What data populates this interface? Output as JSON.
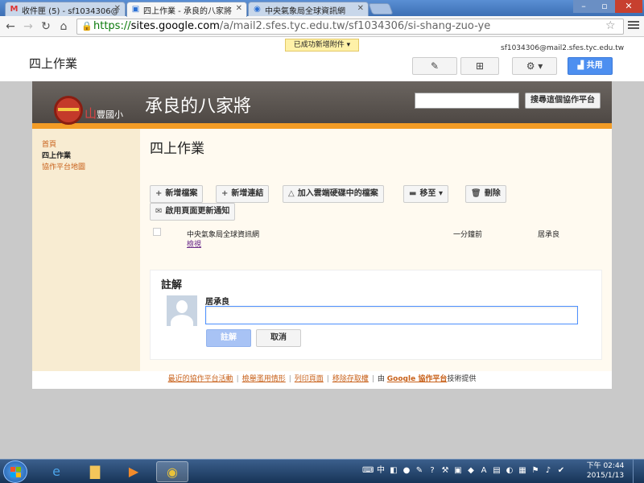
{
  "browser": {
    "tabs": [
      {
        "title": "收件匣 (5) - sf1034306@",
        "favicon": "gmail-icon"
      },
      {
        "title": "四上作業 - 承良的八家將",
        "favicon": "sites-icon"
      },
      {
        "title": "中央氣象局全球資訊網",
        "favicon": "weather-icon"
      }
    ],
    "url_https": "https://",
    "url_host": "sites.google.com",
    "url_path": "/a/mail2.sfes.tyc.edu.tw/sf1034306/si-shang-zuo-ye"
  },
  "sites_header": {
    "notice": "已成功新增附件",
    "user_email": "sf1034306@mail2.sfes.tyc.edu.tw",
    "page_title": "四上作業",
    "share_label": "共用"
  },
  "site": {
    "logo_text_red": "山",
    "logo_text": "豐國小",
    "name": "承良的八家將",
    "search_button": "搜尋這個協作平台",
    "nav": [
      "首頁",
      "四上作業",
      "協作平台地圖"
    ],
    "main_title": "四上作業",
    "actions": {
      "new_file": "新增檔案",
      "new_link": "新增連結",
      "add_drive": "加入雲端硬碟中的檔案",
      "move_to": "移至",
      "delete": "刪除",
      "notify": "啟用頁面更新通知"
    },
    "file": {
      "name": "中央氣象局全球資訊網",
      "link": "檢視",
      "time": "一分鐘前",
      "owner": "居承良"
    },
    "comments": {
      "title": "註解",
      "author": "居承良",
      "input_value": "",
      "post": "註解",
      "cancel": "取消"
    },
    "footer": {
      "recent": "最近的協作平台活動",
      "abuse": "檢舉濫用情形",
      "print": "列印頁面",
      "unsubscribe": "移除存取權",
      "by": "由",
      "google_sites": "Google 協作平台",
      "provided": "技術提供"
    }
  },
  "taskbar": {
    "clock_time": "下午 02:44",
    "clock_date": "2015/1/13",
    "ime": "中"
  },
  "colors": {
    "accent_orange": "#f39c26",
    "site_header": "#5a5450",
    "share_blue": "#4d8ff0"
  }
}
